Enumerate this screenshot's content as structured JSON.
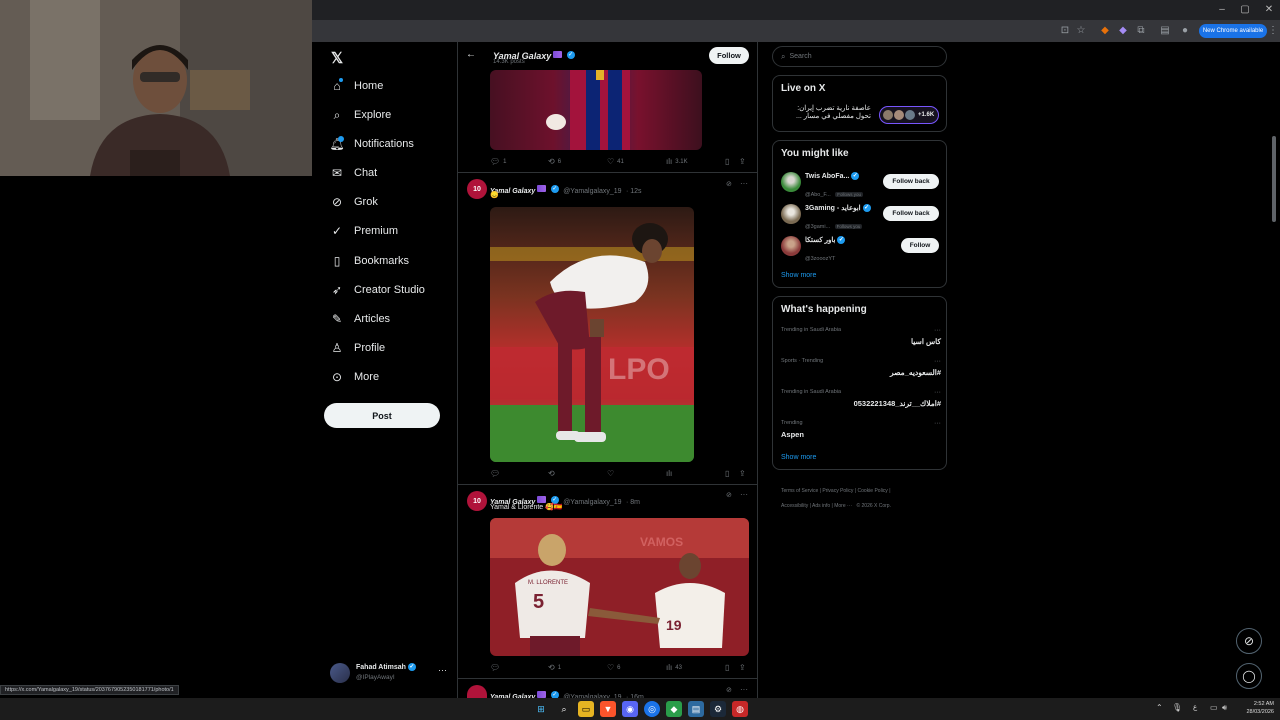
{
  "browser": {
    "new_chrome_label": "New Chrome available",
    "status_url": "https://x.com/Yamalgalaxy_19/status/2037679052350181771/photo/1"
  },
  "nav": {
    "items": [
      {
        "label": "Home",
        "icon": "home-icon"
      },
      {
        "label": "Explore",
        "icon": "search-icon"
      },
      {
        "label": "Notifications",
        "icon": "bell-icon"
      },
      {
        "label": "Chat",
        "icon": "chat-icon"
      },
      {
        "label": "Grok",
        "icon": "grok-icon"
      },
      {
        "label": "Premium",
        "icon": "premium-icon"
      },
      {
        "label": "Bookmarks",
        "icon": "bookmark-icon"
      },
      {
        "label": "Creator Studio",
        "icon": "rocket-icon"
      },
      {
        "label": "Articles",
        "icon": "article-icon"
      },
      {
        "label": "Profile",
        "icon": "person-icon"
      },
      {
        "label": "More",
        "icon": "more-circle-icon"
      }
    ],
    "post_label": "Post",
    "account": {
      "name": "Fahad Atimsah",
      "handle": "@IPlayAwayI"
    }
  },
  "profile_header": {
    "name": "Yamal Galaxy",
    "posts": "14.3K posts",
    "follow_label": "Follow"
  },
  "tweets": [
    {
      "stats": {
        "replies": "1",
        "retweets": "6",
        "likes": "41",
        "views": "3.1K"
      }
    },
    {
      "name": "Yamal Galaxy",
      "handle": "@Yamalgalaxy_19",
      "time": "· 12s",
      "text": "😞",
      "stats": {
        "replies": "",
        "retweets": "",
        "likes": "",
        "views": ""
      }
    },
    {
      "name": "Yamal Galaxy",
      "handle": "@Yamalgalaxy_19",
      "time": "· 8m",
      "text": "Yamal & Llorente 🥰🇪🇸",
      "stats": {
        "replies": "",
        "retweets": "1",
        "likes": "6",
        "views": "43"
      },
      "jersey_left": "5",
      "jersey_right": "19",
      "jersey_left_name": "M. LLORENTE"
    },
    {
      "name": "Yamal Galaxy",
      "handle": "@Yamalgalaxy_19",
      "time": "· 16m"
    }
  ],
  "avatar_text": "10",
  "search": {
    "placeholder": "Search"
  },
  "live": {
    "title": "Live on X",
    "text_line1": "عاصفة نارية تضرب إيران:",
    "text_line2": "تحول مفصلي في مسار ...",
    "count": "+1.6K"
  },
  "suggestions": {
    "title": "You might like",
    "items": [
      {
        "name": "Twis AboFa...",
        "handle": "@Abo_F...",
        "badge": "Follows you",
        "button": "Follow back"
      },
      {
        "name": "3Gaming - ابوعايد",
        "handle": "@3gami...",
        "badge": "Follows you",
        "button": "Follow back"
      },
      {
        "name": "باور كستكا",
        "handle": "@3zooozYT",
        "badge": "",
        "button": "Follow"
      }
    ],
    "show_more": "Show more"
  },
  "trends": {
    "title": "What's happening",
    "items": [
      {
        "context": "Trending in Saudi Arabia",
        "name": "كاس اسيا"
      },
      {
        "context": "Sports · Trending",
        "name": "#السعوديه_مصر"
      },
      {
        "context": "Trending in Saudi Arabia",
        "name": "#املاك__ترند_0532221348"
      },
      {
        "context": "Trending",
        "name": "Aspen"
      }
    ],
    "show_more": "Show more"
  },
  "footer": {
    "links": [
      "Terms of Service",
      "Privacy Policy",
      "Cookie Policy",
      "Accessibility",
      "Ads info",
      "More ···",
      "© 2026 X Corp."
    ]
  },
  "taskbar": {
    "time": "2:52 AM",
    "date": "28/03/2026",
    "lang": "ع"
  },
  "colors": {
    "accent": "#1d9bf0",
    "background": "#000000",
    "border": "#2f3336",
    "muted": "#71767b"
  }
}
